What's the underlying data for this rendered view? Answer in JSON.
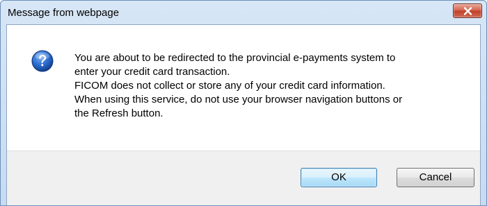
{
  "dialog": {
    "title": "Message from webpage",
    "icon": "question-icon",
    "message_lines": [
      "You are about to be redirected to the provincial e-payments system to",
      "enter your credit card transaction.",
      "FICOM does not collect or store any of your credit card information.",
      "When using this service, do not use your browser navigation buttons or",
      "the Refresh button."
    ],
    "ok_label": "OK",
    "cancel_label": "Cancel"
  },
  "colors": {
    "close_button": "#c7432d",
    "ok_button_border": "#3c7fb1",
    "icon_blue": "#1f5fbf"
  }
}
